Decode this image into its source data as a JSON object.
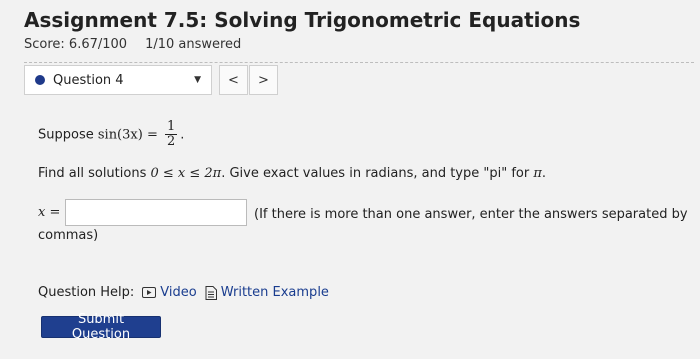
{
  "header": {
    "title": "Assignment 7.5: Solving Trigonometric Equations",
    "score": "Score: 6.67/100",
    "answered": "1/10 answered"
  },
  "question_nav": {
    "selected": "Question 4",
    "prev": "<",
    "next": ">"
  },
  "question": {
    "suppose_prefix": "Suppose ",
    "equation_lhs": "sin(3x) = ",
    "fraction_num": "1",
    "fraction_den": "2",
    "equation_end": ".",
    "find_prefix": "Find all solutions ",
    "interval": "0 ≤ x ≤ 2π",
    "find_suffix": ". Give exact values in radians, and type \"pi\" for ",
    "pi": "π",
    "find_end": ".",
    "var_label": "x =",
    "instruction_line1": "(If there is more than one answer, enter the answers separated by",
    "instruction_line2": "commas)"
  },
  "help": {
    "label": "Question Help:",
    "video": "Video",
    "written": "Written Example"
  },
  "submit_label": "Submit Question",
  "colors": {
    "accent": "#1f3f8f",
    "link": "#1a3d8f"
  }
}
